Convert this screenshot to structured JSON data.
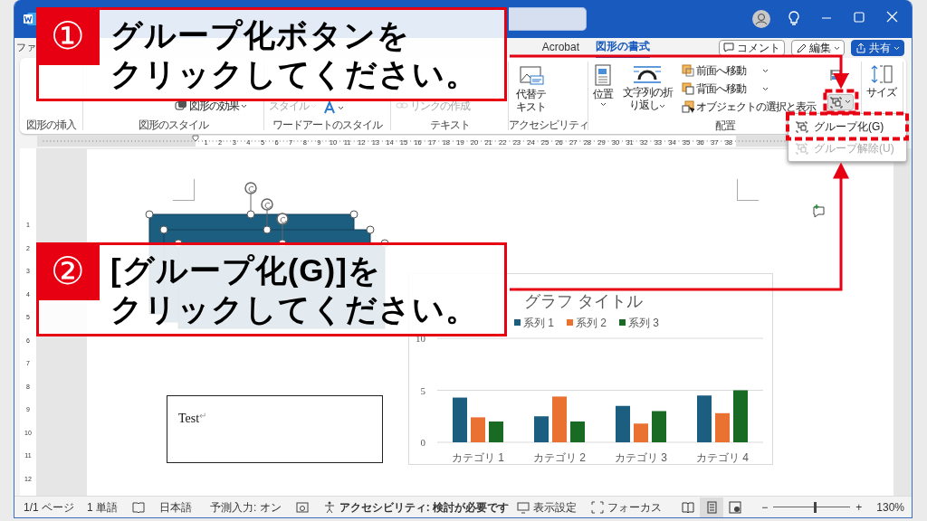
{
  "tabs": [
    {
      "label": "ファ",
      "selected": false
    },
    {
      "label": "Acrobat",
      "selected": false
    },
    {
      "label": "図形の書式",
      "selected": true
    }
  ],
  "header_buttons": [
    {
      "kind": "comment",
      "label": "コメント"
    },
    {
      "kind": "edit",
      "label": "編集"
    },
    {
      "kind": "share",
      "label": "共有"
    }
  ],
  "ribbon": {
    "groups": [
      {
        "label": "図形の挿入"
      },
      {
        "label": "図形のスタイル",
        "items": [
          {
            "kind": "effects",
            "label": "図形の効果",
            "disabled": false
          }
        ]
      },
      {
        "label": "ワードアートのスタイル",
        "items": [
          {
            "kind": "quickstyle",
            "label": "スタイル",
            "disabled": true
          },
          {
            "kind": "textfill",
            "disabled": false
          }
        ]
      },
      {
        "label": "テキスト",
        "items": [
          {
            "kind": "link",
            "label": "リンクの作成",
            "disabled": true
          }
        ]
      },
      {
        "label": "アクセシビリティ",
        "items": [
          {
            "kind": "alttext",
            "label": "代替テキスト",
            "disabled": false
          }
        ]
      },
      {
        "label": "配置",
        "items": [
          {
            "kind": "position",
            "label": "位置",
            "disabled": false
          },
          {
            "kind": "wrap",
            "label": "文字列の折り返し",
            "disabled": false
          },
          {
            "kind": "forward",
            "label": "前面へ移動",
            "disabled": false
          },
          {
            "kind": "backward",
            "label": "背面へ移動",
            "disabled": false
          },
          {
            "kind": "selection",
            "label": "オブジェクトの選択と表示",
            "disabled": false
          },
          {
            "kind": "align",
            "disabled": false
          },
          {
            "kind": "group",
            "disabled": false
          }
        ]
      },
      {
        "items": [
          {
            "kind": "size",
            "label": "サイズ",
            "disabled": false
          }
        ]
      }
    ]
  },
  "dropdown_menu": [
    {
      "label": "グループ化(G)",
      "disabled": false
    },
    {
      "label": "グループ解除(U)",
      "disabled": true
    }
  ],
  "ruler": {
    "labels": [
      "1",
      "2",
      "3",
      "4",
      "5",
      "6",
      "7",
      "8",
      "9",
      "10",
      "11",
      "12",
      "13",
      "14",
      "15",
      "16",
      "17",
      "18",
      "19",
      "20",
      "21",
      "22",
      "23",
      "24",
      "25",
      "26",
      "27",
      "28",
      "29",
      "30",
      "31",
      "32",
      "33",
      "34",
      "35",
      "36",
      "37",
      "38"
    ],
    "vertical_labels": [
      "1",
      "2",
      "3",
      "4",
      "5",
      "6",
      "7",
      "8",
      "9",
      "10",
      "11",
      "12"
    ]
  },
  "document": {
    "text_box": {
      "text": "Test",
      "mark": "↵"
    },
    "chart": {
      "chart_data": {
        "type": "bar",
        "title": "グラフ タイトル",
        "legend": "top",
        "categories": [
          "カテゴリ 1",
          "カテゴリ 2",
          "カテゴリ 3",
          "カテゴリ 4"
        ],
        "series": [
          {
            "name": "系列 1",
            "color": "#1b5e80",
            "values": [
              4.3,
              2.5,
              3.5,
              4.5
            ]
          },
          {
            "name": "系列 2",
            "color": "#e97132",
            "values": [
              2.4,
              4.4,
              1.8,
              2.8
            ]
          },
          {
            "name": "系列 3",
            "color": "#196b24",
            "values": [
              2,
              2,
              3,
              5
            ]
          }
        ],
        "ylim": [
          0,
          10
        ],
        "yticks": [
          0,
          5,
          10
        ]
      }
    }
  },
  "callouts": [
    {
      "number": "①",
      "lines": [
        "グループ化ボタンを",
        "クリックしてください。"
      ]
    },
    {
      "number": "②",
      "lines": [
        "[グループ化(G)]を",
        "クリックしてください。"
      ]
    }
  ],
  "status_bar": {
    "left": [
      {
        "kind": "plain",
        "label": "1/1 ページ"
      },
      {
        "kind": "plain",
        "label": "1 単語"
      },
      {
        "kind": "language",
        "label": "日本語"
      },
      {
        "kind": "plain",
        "label": "予測入力: オン"
      },
      {
        "kind": "macro"
      },
      {
        "kind": "accessibility",
        "label": "アクセシビリティ: 検討が必要です"
      }
    ],
    "right": [
      {
        "kind": "display",
        "label": "表示設定"
      },
      {
        "kind": "focus",
        "label": "フォーカス"
      }
    ],
    "views": [
      {
        "kind": "read",
        "selected": false
      },
      {
        "kind": "print",
        "selected": true
      },
      {
        "kind": "web",
        "selected": false
      }
    ],
    "zoom": {
      "out": "−",
      "in": "+",
      "level": 0.55,
      "reading": "130%"
    }
  }
}
